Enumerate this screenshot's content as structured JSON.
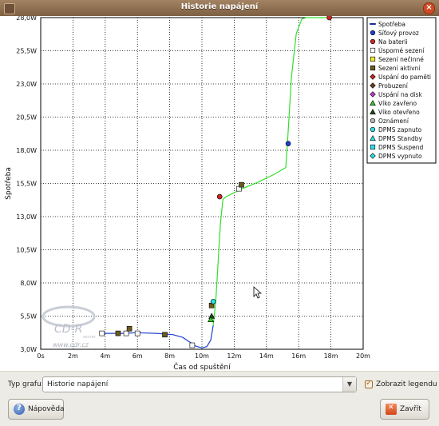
{
  "window": {
    "title": "Historie napájení"
  },
  "chart_data": {
    "type": "line",
    "title": "",
    "xlabel": "Čas od spuštění",
    "ylabel": "Spotřeba",
    "x_unit": "minutes",
    "xlim": [
      0,
      20
    ],
    "ylim": [
      3.0,
      28.0
    ],
    "x_ticks": [
      "0s",
      "2m",
      "4m",
      "6m",
      "8m",
      "10m",
      "12m",
      "14m",
      "16m",
      "18m",
      "20m"
    ],
    "y_ticks": [
      "3,0W",
      "5,5W",
      "8,0W",
      "10,5W",
      "13,0W",
      "15,5W",
      "18,0W",
      "20,5W",
      "23,0W",
      "25,5W",
      "28,0W"
    ],
    "grid": true,
    "legend_position": "right",
    "series": [
      {
        "name": "Spotřeba",
        "color_battery": "#1f3fcf",
        "color_ac": "#31e02b",
        "battery_points": [
          [
            3.8,
            4.2
          ],
          [
            5.0,
            4.2
          ],
          [
            6.0,
            4.25
          ],
          [
            7.2,
            4.2
          ],
          [
            8.2,
            4.1
          ],
          [
            8.8,
            3.9
          ],
          [
            9.3,
            3.5
          ],
          [
            9.6,
            3.25
          ],
          [
            10.0,
            3.1
          ],
          [
            10.3,
            3.2
          ],
          [
            10.55,
            3.7
          ],
          [
            10.7,
            4.8
          ]
        ],
        "ac_points": [
          [
            10.7,
            4.8
          ],
          [
            10.85,
            6.5
          ],
          [
            11.0,
            9.5
          ],
          [
            11.15,
            12.5
          ],
          [
            11.3,
            14.3
          ],
          [
            11.5,
            14.5
          ],
          [
            12.5,
            15.1
          ],
          [
            13.5,
            15.6
          ],
          [
            14.5,
            16.2
          ],
          [
            15.2,
            16.7
          ],
          [
            15.3,
            18.5
          ],
          [
            15.55,
            23.5
          ],
          [
            15.85,
            26.8
          ],
          [
            16.2,
            27.9
          ],
          [
            16.5,
            28.0
          ],
          [
            17.9,
            28.0
          ]
        ]
      }
    ],
    "events": [
      {
        "type": "Úsporné sezení",
        "x": 3.8,
        "y": 4.2
      },
      {
        "type": "Sezení aktivní",
        "x": 4.8,
        "y": 4.2
      },
      {
        "type": "Úsporné sezení",
        "x": 5.3,
        "y": 4.2
      },
      {
        "type": "Sezení aktivní",
        "x": 5.5,
        "y": 4.55
      },
      {
        "type": "Úsporné sezení",
        "x": 6.0,
        "y": 4.2
      },
      {
        "type": "Sezení aktivní",
        "x": 7.7,
        "y": 4.1
      },
      {
        "type": "Úsporné sezení",
        "x": 9.4,
        "y": 3.3
      },
      {
        "type": "Víko otevřeno",
        "x": 10.6,
        "y": 5.5
      },
      {
        "type": "Víko zavřeno",
        "x": 10.55,
        "y": 5.25
      },
      {
        "type": "Sezení aktivní",
        "x": 10.6,
        "y": 6.3
      },
      {
        "type": "DPMS zapnuto",
        "x": 10.7,
        "y": 6.6
      },
      {
        "type": "Na baterii",
        "x": 11.1,
        "y": 14.5
      },
      {
        "type": "Úsporné sezení",
        "x": 12.3,
        "y": 15.1
      },
      {
        "type": "Sezení aktivní",
        "x": 12.45,
        "y": 15.4
      },
      {
        "type": "Síťový provoz",
        "x": 15.35,
        "y": 18.5
      },
      {
        "type": "Na baterii",
        "x": 17.9,
        "y": 28.0
      }
    ],
    "legend": [
      {
        "label": "Spotřeba",
        "marker": "line",
        "color": "#1a2a9a"
      },
      {
        "label": "Síťový provoz",
        "marker": "circle",
        "color": "#1f3fcf"
      },
      {
        "label": "Na baterii",
        "marker": "circle",
        "color": "#d32323"
      },
      {
        "label": "Úsporné sezení",
        "marker": "square",
        "color": "#ffffff"
      },
      {
        "label": "Sezení nečinné",
        "marker": "square",
        "color": "#f1e92b"
      },
      {
        "label": "Sezení aktivní",
        "marker": "square",
        "color": "#6b5a1f"
      },
      {
        "label": "Uspání do paměti",
        "marker": "diamond",
        "color": "#c2271e"
      },
      {
        "label": "Probuzení",
        "marker": "diamond",
        "color": "#6b3f1e"
      },
      {
        "label": "Uspání na disk",
        "marker": "diamond",
        "color": "#b93cc8"
      },
      {
        "label": "Víko zavřeno",
        "marker": "triangle",
        "color": "#39c82b"
      },
      {
        "label": "Víko otevřeno",
        "marker": "triangle",
        "color": "#1e4a1a"
      },
      {
        "label": "Oznámení",
        "marker": "circle",
        "color": "#b9b9b9"
      },
      {
        "label": "DPMS zapnuto",
        "marker": "circle",
        "color": "#2be0e8"
      },
      {
        "label": "DPMS Standby",
        "marker": "triangle",
        "color": "#2be0e8"
      },
      {
        "label": "DPMS Suspend",
        "marker": "square",
        "color": "#2be0e8"
      },
      {
        "label": "DPMS vypnuto",
        "marker": "diamond",
        "color": "#2be0e8"
      }
    ]
  },
  "watermark": {
    "text": "CD-R",
    "sub": "www.cdr.cz",
    "server": "server"
  },
  "controls": {
    "graph_type_label": "Typ grafu:",
    "graph_type_value": "Historie napájení",
    "show_legend_label": "Zobrazit legendu",
    "show_legend_checked": true
  },
  "buttons": {
    "help_label": "Nápověda",
    "close_label": "Zavřít"
  }
}
